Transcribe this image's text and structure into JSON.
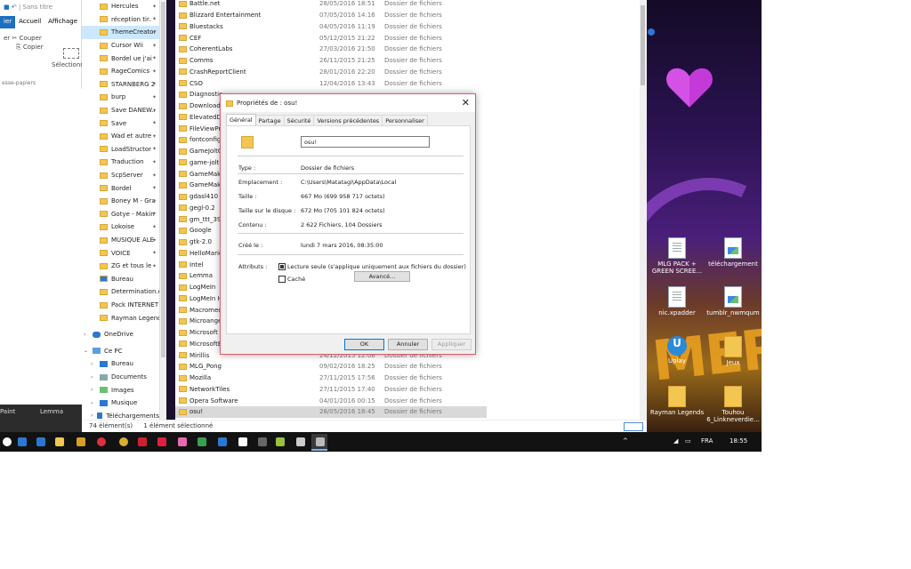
{
  "ribbon": {
    "qat_text": "| Sans titre",
    "tabs": [
      "ier",
      "Accueil",
      "Affichage"
    ],
    "copy_label": "Couper",
    "paste_label": "Copier",
    "select_label": "Sélectionner",
    "group_label": "esse-papiers",
    "paste_short": "er"
  },
  "nav": {
    "quick_access": [
      {
        "label": "Hercules",
        "sel": false
      },
      {
        "label": "réception tir.",
        "sel": false
      },
      {
        "label": "ThemeCreator",
        "sel": true
      },
      {
        "label": "Cursor Wii",
        "sel": false
      },
      {
        "label": "Bordel ue j'ai",
        "sel": false
      },
      {
        "label": "RageComics",
        "sel": false
      },
      {
        "label": "STARNBERG 2",
        "sel": false
      },
      {
        "label": "burp",
        "sel": false
      },
      {
        "label": "Save DANEW..",
        "sel": false
      },
      {
        "label": "Save",
        "sel": false
      },
      {
        "label": "Wad et autre",
        "sel": false
      },
      {
        "label": "LoadStructor",
        "sel": false
      },
      {
        "label": "Traduction",
        "sel": false
      },
      {
        "label": "ScpServer",
        "sel": false
      },
      {
        "label": "Bordel",
        "sel": false
      },
      {
        "label": "Boney M - Gra",
        "sel": false
      },
      {
        "label": "Gotye - Makin",
        "sel": false
      },
      {
        "label": "Lokoise",
        "sel": false
      },
      {
        "label": "MUSIQUE ALE",
        "sel": false
      },
      {
        "label": "VOICE",
        "sel": false
      },
      {
        "label": "ZG et tous le",
        "sel": false
      }
    ],
    "extra_items": [
      "Bureau",
      "Determination.ex",
      "Pack INTERNET",
      "Rayman Legends"
    ],
    "onedrive": "OneDrive",
    "thispc": "Ce PC",
    "pc_items": [
      "Bureau",
      "Documents",
      "Images",
      "Musique",
      "Téléchargements"
    ]
  },
  "files": [
    {
      "name": "Battle.net",
      "date": "28/05/2016 18:51",
      "type": "Dossier de fichiers"
    },
    {
      "name": "Blizzard Entertainment",
      "date": "07/05/2016 14:16",
      "type": "Dossier de fichiers"
    },
    {
      "name": "Bluestacks",
      "date": "04/05/2016 11:19",
      "type": "Dossier de fichiers"
    },
    {
      "name": "CEF",
      "date": "05/12/2015 21:22",
      "type": "Dossier de fichiers"
    },
    {
      "name": "CoherentLabs",
      "date": "27/03/2016 21:50",
      "type": "Dossier de fichiers"
    },
    {
      "name": "Comms",
      "date": "26/11/2015 21:25",
      "type": "Dossier de fichiers"
    },
    {
      "name": "CrashReportClient",
      "date": "28/01/2016 22:20",
      "type": "Dossier de fichiers"
    },
    {
      "name": "CSO",
      "date": "12/04/2016 13:43",
      "type": "Dossier de fichiers"
    },
    {
      "name": "Diagnostic",
      "date": "",
      "type": ""
    },
    {
      "name": "Downloade",
      "date": "",
      "type": ""
    },
    {
      "name": "ElevatedDi",
      "date": "",
      "type": ""
    },
    {
      "name": "FileViewPro",
      "date": "",
      "type": ""
    },
    {
      "name": "fontconfig",
      "date": "",
      "type": ""
    },
    {
      "name": "GameJoltC",
      "date": "",
      "type": ""
    },
    {
      "name": "game-jolt-",
      "date": "",
      "type": ""
    },
    {
      "name": "GameMaker",
      "date": "",
      "type": ""
    },
    {
      "name": "GameMaker",
      "date": "",
      "type": ""
    },
    {
      "name": "gdasl410",
      "date": "",
      "type": ""
    },
    {
      "name": "gegl-0.2",
      "date": "",
      "type": ""
    },
    {
      "name": "gm_ttt_39",
      "date": "",
      "type": ""
    },
    {
      "name": "Google",
      "date": "",
      "type": ""
    },
    {
      "name": "gtk-2.0",
      "date": "",
      "type": ""
    },
    {
      "name": "HelloMario",
      "date": "",
      "type": ""
    },
    {
      "name": "Intel",
      "date": "",
      "type": ""
    },
    {
      "name": "Lemma",
      "date": "",
      "type": ""
    },
    {
      "name": "LogMeIn",
      "date": "",
      "type": ""
    },
    {
      "name": "LogMeIn H",
      "date": "",
      "type": ""
    },
    {
      "name": "Macromedia",
      "date": "",
      "type": ""
    },
    {
      "name": "Microangel",
      "date": "",
      "type": ""
    },
    {
      "name": "Microsoft",
      "date": "",
      "type": ""
    },
    {
      "name": "MicrosoftE",
      "date": "",
      "type": ""
    },
    {
      "name": "Mirillis",
      "date": "24/12/2015 12:06",
      "type": "Dossier de fichiers"
    },
    {
      "name": "MLG_Pong",
      "date": "09/02/2016 18:25",
      "type": "Dossier de fichiers"
    },
    {
      "name": "Mozilla",
      "date": "27/11/2015 17:56",
      "type": "Dossier de fichiers"
    },
    {
      "name": "NetworkTiles",
      "date": "27/11/2015 17:40",
      "type": "Dossier de fichiers"
    },
    {
      "name": "Opera Software",
      "date": "04/01/2016 00:15",
      "type": "Dossier de fichiers"
    },
    {
      "name": "osu!",
      "date": "28/05/2016 18:45",
      "type": "Dossier de fichiers"
    }
  ],
  "status": {
    "count": "74 élément(s)",
    "selected": "1 élément sélectionné"
  },
  "taskthumb": {
    "left": "Paint",
    "right": "Lemma"
  },
  "dialog": {
    "title": "Propriétés de : osu!",
    "tabs": [
      "Général",
      "Partage",
      "Sécurité",
      "Versions précédentes",
      "Personnaliser"
    ],
    "name_value": "osu!",
    "rows": [
      {
        "label": "Type :",
        "value": "Dossier de fichiers"
      },
      {
        "label": "Emplacement :",
        "value": "C:\\Users\\Matatagi\\AppData\\Local"
      },
      {
        "label": "Taille :",
        "value": "667 Mo (699 958 717 octets)"
      },
      {
        "label": "Taille sur le disque :",
        "value": "672 Mo (705 101 824 octets)"
      },
      {
        "label": "Contenu :",
        "value": "2 622 Fichiers, 104 Dossiers"
      },
      {
        "label": "Créé le :",
        "value": "lundi 7 mars 2016, 08:35:00"
      }
    ],
    "attributes_label": "Attributs :",
    "readonly_label": "Lecture seule (s'applique uniquement aux fichiers du dossier)",
    "hidden_label": "Caché",
    "advanced_label": "Avancé...",
    "ok_label": "OK",
    "cancel_label": "Annuler",
    "apply_label": "Appliquer"
  },
  "desktop": {
    "icons": [
      {
        "label": "MLG PACK + GREEN SCREE..."
      },
      {
        "label": "téléchargement"
      },
      {
        "label": "nic.xpadder"
      },
      {
        "label": "tumblr_nwmqum"
      },
      {
        "label": "Uplay"
      },
      {
        "label": "Jeux"
      },
      {
        "label": "Rayman Legends"
      },
      {
        "label": "Touhou 6_Linkneverdie..."
      }
    ]
  },
  "tray": {
    "lang": "FRA",
    "time": "18:55"
  },
  "colors": {
    "accent": "#0078d7",
    "selection": "#cce8ff",
    "dialog_border": "#e15a6a",
    "taskbar": "#121212"
  }
}
